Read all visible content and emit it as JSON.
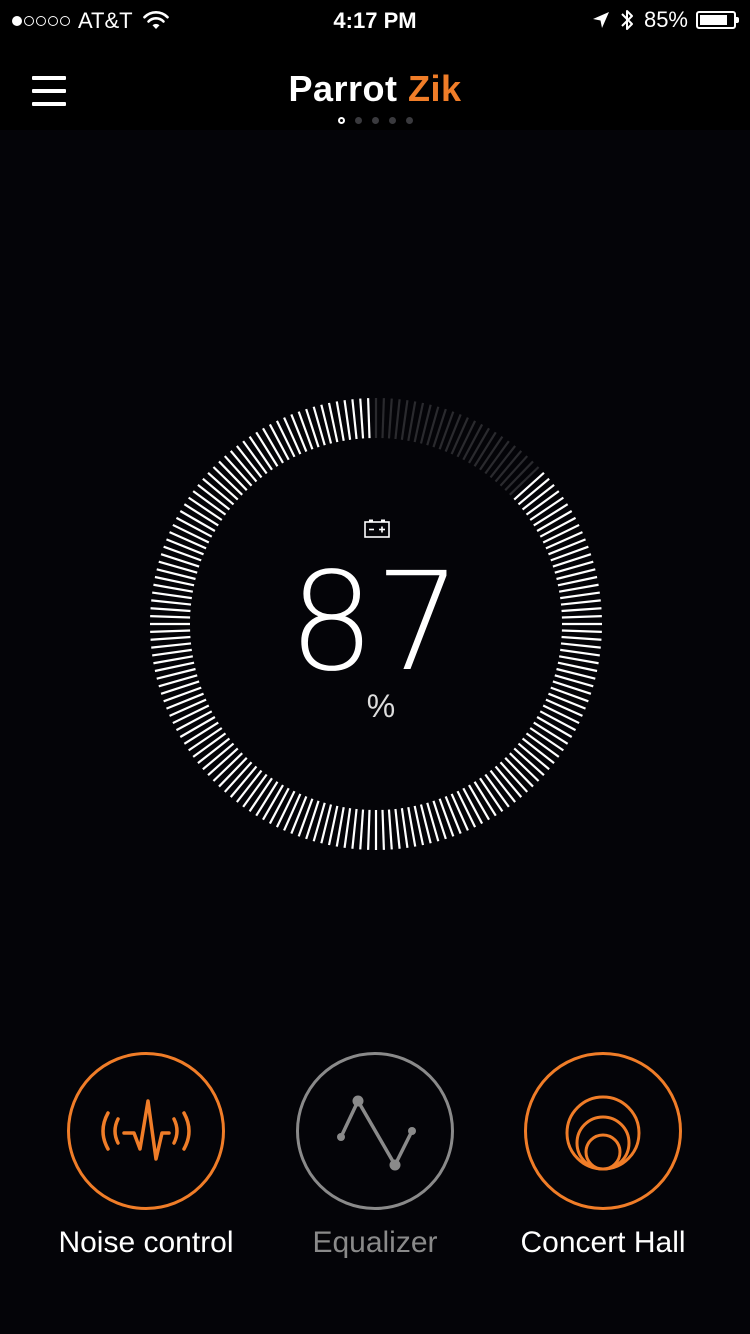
{
  "status_bar": {
    "carrier": "AT&T",
    "time": "4:17 PM",
    "battery_percent": "85%",
    "battery_level": 0.85,
    "signal_bars": 1,
    "icons": [
      "wifi-icon",
      "location-arrow-icon",
      "bluetooth-icon",
      "battery-icon"
    ]
  },
  "header": {
    "title_main": "Parrot",
    "title_accent": "Zik",
    "menu_icon": "hamburger-menu-icon",
    "page_count": 5,
    "active_page": 0
  },
  "battery": {
    "value": "87",
    "unit": "%",
    "level": 0.87,
    "icon": "battery-charge-icon"
  },
  "features": [
    {
      "label": "Noise control",
      "icon": "noise-wave-icon",
      "enabled": true
    },
    {
      "label": "Equalizer",
      "icon": "equalizer-curve-icon",
      "enabled": false
    },
    {
      "label": "Concert Hall",
      "icon": "concert-hall-circles-icon",
      "enabled": true
    }
  ],
  "colors": {
    "accent": "#f07d28",
    "background": "#040408",
    "inactive": "#8a8a8a",
    "gauge_dim": "#2a2a2e"
  }
}
